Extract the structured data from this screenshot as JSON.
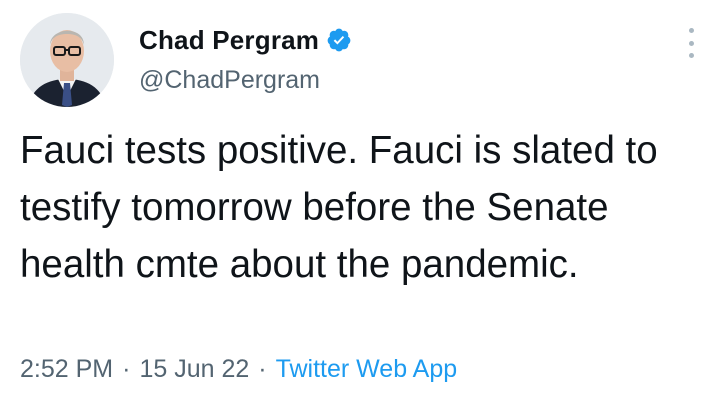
{
  "author": {
    "display_name": "Chad Pergram",
    "handle": "@ChadPergram",
    "verified": true,
    "avatar": "profile-photo"
  },
  "tweet": {
    "text": "Fauci tests positive. Fauci is slated to testify tomorrow before the Senate health cmte about the pandemic.",
    "time": "2:52 PM",
    "date": "15 Jun 22",
    "separator": "·",
    "source": "Twitter Web App"
  },
  "icons": {
    "verified": "verified-badge-icon",
    "more": "more-options-icon"
  },
  "colors": {
    "verified_badge": "#1d9bf0",
    "link": "#1d9bf0",
    "secondary_text": "#536471"
  }
}
